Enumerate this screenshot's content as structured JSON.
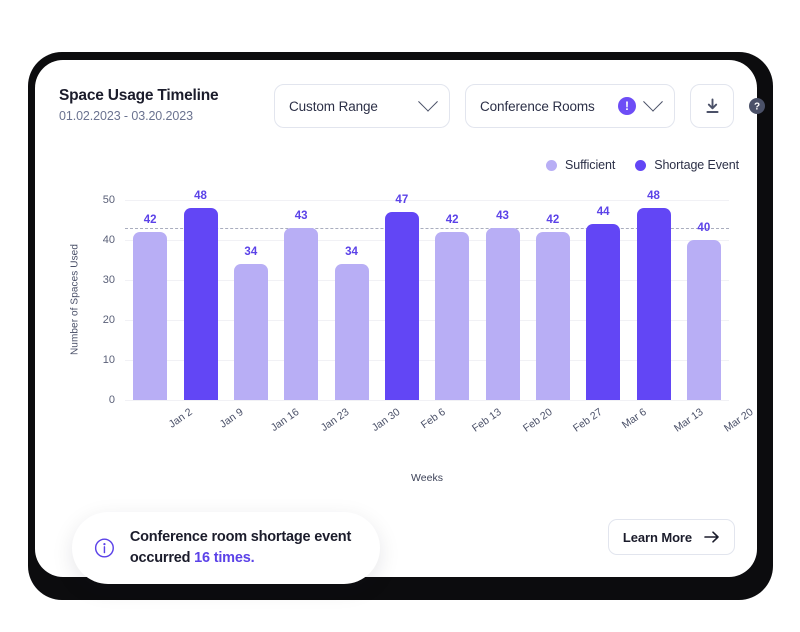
{
  "header": {
    "title": "Space Usage Timeline",
    "date_range": "01.02.2023 - 03.20.2023",
    "range_select": {
      "value": "Custom Range",
      "icon": "chevron-down-icon"
    },
    "space_select": {
      "value": "Conference Rooms",
      "badge": "!",
      "icon": "chevron-down-icon"
    },
    "download": {
      "icon": "download-icon"
    },
    "help": {
      "icon": "help-circle-icon",
      "glyph": "?"
    }
  },
  "legend": {
    "items": [
      {
        "label": "Sufficient",
        "color": "#b8aef5"
      },
      {
        "label": "Shortage Event",
        "color": "#6246f5"
      }
    ]
  },
  "footer": {
    "learn_more_label": "Learn More",
    "learn_more_icon": "arrow-right-icon"
  },
  "toast": {
    "icon": "info-circle-icon",
    "text_before": "Conference room shortage event occurred ",
    "highlight": "16 times.",
    "highlight_color": "#5b42e8"
  },
  "chart_data": {
    "type": "bar",
    "title": "Space Usage Timeline",
    "xlabel": "Weeks",
    "ylabel": "Number of Spaces Used",
    "ylim": [
      0,
      50
    ],
    "yticks": [
      0,
      10,
      20,
      30,
      40,
      50
    ],
    "grid": true,
    "legend_position": "top-right",
    "reference_line": {
      "value": 43,
      "style": "dashed",
      "color": "#a9adbe"
    },
    "categories": [
      "Jan 2",
      "Jan 9",
      "Jan 16",
      "Jan 23",
      "Jan 30",
      "Feb 6",
      "Feb 13",
      "Feb 20",
      "Feb 27",
      "Mar 6",
      "Mar 13",
      "Mar 20"
    ],
    "values": [
      42,
      48,
      34,
      43,
      34,
      47,
      42,
      43,
      42,
      44,
      48,
      40
    ],
    "point_categories": [
      "Sufficient",
      "Shortage Event",
      "Sufficient",
      "Sufficient",
      "Sufficient",
      "Shortage Event",
      "Sufficient",
      "Sufficient",
      "Sufficient",
      "Shortage Event",
      "Shortage Event",
      "Sufficient"
    ],
    "colors": {
      "Sufficient": "#b8aef5",
      "Shortage Event": "#6246f5"
    },
    "label_color": "#5b42e8"
  }
}
